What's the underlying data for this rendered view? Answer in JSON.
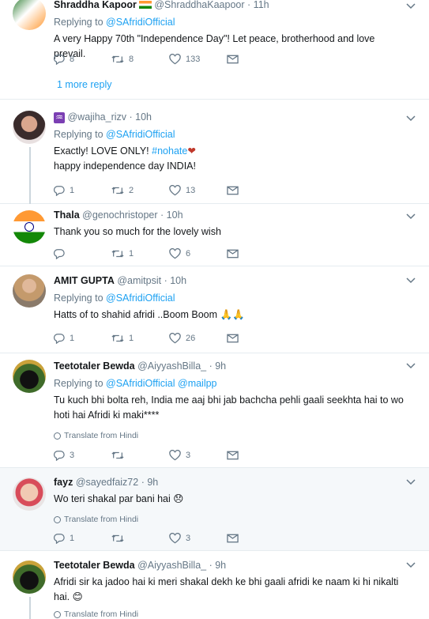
{
  "tweets": [
    {
      "name": "Shraddha Kapoor",
      "handle": "@ShraddhaKaapoor",
      "time": "11h",
      "replying_label": "Replying to",
      "replying_to": "@SAfridiOfficial",
      "text": "A very Happy 70th \"Independence Day\"! Let peace, brotherhood and love prevail.",
      "replies": "8",
      "retweets": "8",
      "likes": "133",
      "more_replies": "1 more reply"
    },
    {
      "name": "",
      "handle": "@wajiha_rizv",
      "time": "10h",
      "replying_label": "Replying to",
      "replying_to": "@SAfridiOfficial",
      "text_line1": "Exactly! LOVE ONLY!",
      "hashtag": "#nohate",
      "text_line2": "happy independence day INDIA!",
      "replies": "1",
      "retweets": "2",
      "likes": "13"
    },
    {
      "name": "Thala",
      "handle": "@genochristoper",
      "time": "10h",
      "text": "Thank you so much for the lovely wish",
      "replies": "",
      "retweets": "1",
      "likes": "6"
    },
    {
      "name": "AMIT GUPTA",
      "handle": "@amitpsit",
      "time": "10h",
      "replying_label": "Replying to",
      "replying_to": "@SAfridiOfficial",
      "text": "Hatts of to shahid afridi ..Boom Boom 🙏🙏",
      "replies": "1",
      "retweets": "1",
      "likes": "26"
    },
    {
      "name": "Teetotaler Bewda",
      "handle": "@AiyyashBilla_",
      "time": "9h",
      "replying_label": "Replying to",
      "replying_to": "@SAfridiOfficial",
      "replying_to_2": "@mailpp",
      "text": "Tu kuch bhi bolta reh, India me aaj bhi jab bachcha pehli gaali seekhta hai to wo hoti hai Afridi ki maki****",
      "translate": "Translate from Hindi",
      "replies": "3",
      "retweets": "",
      "likes": "3"
    },
    {
      "name": "fayz",
      "handle": "@sayedfaiz72",
      "time": "9h",
      "text": "Wo teri shakal par bani hai 😞",
      "translate": "Translate from Hindi",
      "replies": "1",
      "retweets": "",
      "likes": "3"
    },
    {
      "name": "Teetotaler Bewda",
      "handle": "@AiyyashBilla_",
      "time": "9h",
      "text": "Afridi sir ka jadoo hai ki meri shakal dekh ke bhi gaali afridi ke naam ki hi nikalti hai. 😊",
      "translate": "Translate from Hindi"
    }
  ],
  "colors": {
    "link": "#1da1f2",
    "muted": "#657786",
    "divider": "#e6ecf0",
    "highlight_bg": "#f5f8fa"
  },
  "icons": [
    "reply-icon",
    "retweet-icon",
    "like-icon",
    "message-icon",
    "chevron-down-icon",
    "globe-icon",
    "aquarius-icon"
  ]
}
